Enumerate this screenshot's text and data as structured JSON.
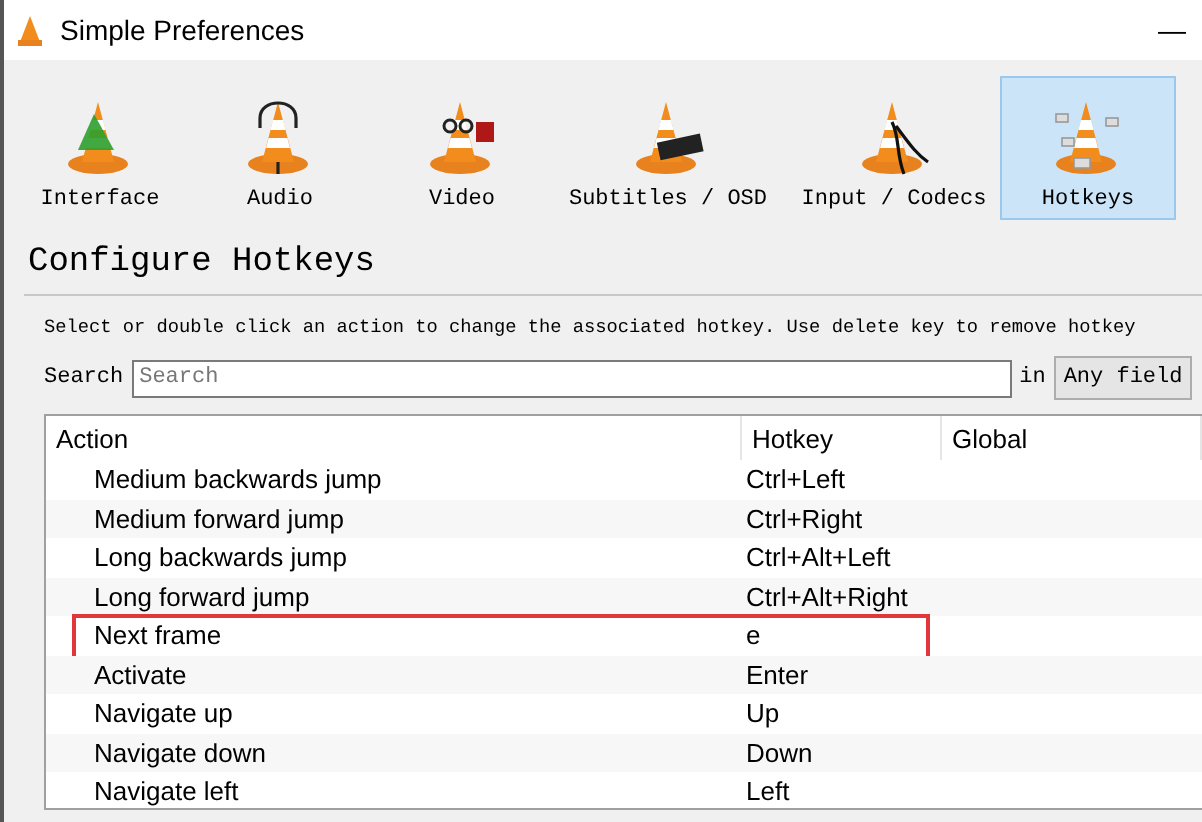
{
  "window": {
    "title": "Simple Preferences",
    "minimize": "—"
  },
  "tabs": [
    {
      "label": "Interface",
      "kind": "interface",
      "selected": false
    },
    {
      "label": "Audio",
      "kind": "audio",
      "selected": false
    },
    {
      "label": "Video",
      "kind": "video",
      "selected": false
    },
    {
      "label": "Subtitles / OSD",
      "kind": "subtitles",
      "selected": false
    },
    {
      "label": "Input / Codecs",
      "kind": "input",
      "selected": false
    },
    {
      "label": "Hotkeys",
      "kind": "hotkeys",
      "selected": true
    }
  ],
  "heading": "Configure Hotkeys",
  "instructions": "Select or double click an action to change the associated hotkey. Use delete key to remove hotkey",
  "search": {
    "label": "Search",
    "placeholder": "Search",
    "in_label": "in",
    "field_select": "Any field"
  },
  "table": {
    "columns": [
      "Action",
      "Hotkey",
      "Global"
    ],
    "rows": [
      {
        "action": "Medium backwards jump",
        "hotkey": "Ctrl+Left",
        "highlighted": false
      },
      {
        "action": "Medium forward jump",
        "hotkey": "Ctrl+Right",
        "highlighted": false
      },
      {
        "action": "Long backwards jump",
        "hotkey": "Ctrl+Alt+Left",
        "highlighted": false
      },
      {
        "action": "Long forward jump",
        "hotkey": "Ctrl+Alt+Right",
        "highlighted": false
      },
      {
        "action": "Next frame",
        "hotkey": "e",
        "highlighted": true
      },
      {
        "action": "Activate",
        "hotkey": "Enter",
        "highlighted": false
      },
      {
        "action": "Navigate up",
        "hotkey": "Up",
        "highlighted": false
      },
      {
        "action": "Navigate down",
        "hotkey": "Down",
        "highlighted": false
      },
      {
        "action": "Navigate left",
        "hotkey": "Left",
        "highlighted": false
      }
    ]
  }
}
